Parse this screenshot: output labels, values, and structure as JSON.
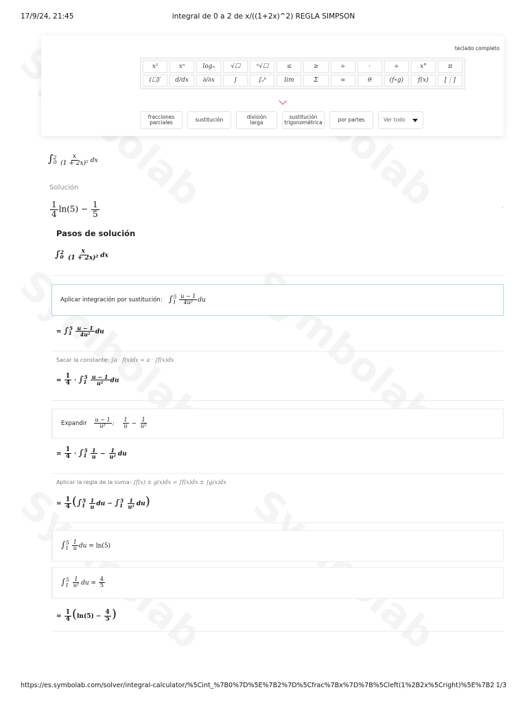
{
  "print_header": {
    "date": "17/9/24, 21:45",
    "title": "integral de 0 a 2 de x/((1+2x)^2) REGLA SIMPSON"
  },
  "watermark": {
    "text": "Symbolab"
  },
  "keyboard": {
    "full_keyboard_label": "teclado completo",
    "keys_row1": [
      "x²",
      "xⁿ",
      "logₙ",
      "√☐",
      "ⁿ√☐",
      "≤",
      "≥",
      "÷",
      "·",
      "÷",
      "x°",
      "π"
    ],
    "keys_row2": [
      "(☐)′",
      "d/dx",
      "∂/∂x",
      "∫",
      "∫ₐᵇ",
      "lim",
      "Σ",
      "∞",
      "θ",
      "(f∘g)",
      "f(x)",
      "[⋮]"
    ],
    "tabs": [
      "fracciones parciales",
      "sustitución",
      "división larga",
      "sustitución trigonométrica",
      "por partes"
    ],
    "select_value": "Ver todo"
  },
  "problem": {
    "lower": "0",
    "upper": "2",
    "numerator": "x",
    "denominator": "(1 + 2x)²",
    "differential": "dx"
  },
  "solution": {
    "label": "Solución",
    "coef_num": "1",
    "coef_den": "4",
    "ln": "ln(5)",
    "minus": "−",
    "frac_num": "1",
    "frac_den": "5"
  },
  "steps": {
    "title": "Pasos de solución",
    "step1_label": "Aplicar integración por sustitución:",
    "step2_label": "Sacar la constante:",
    "step2_rule": "∫a · f(x)dx = a · ∫f(x)dx",
    "step3_label": "Expandir",
    "step4_label": "Aplicar la regla de la suma:",
    "step4_rule": "∫f(x) ± g(x)dx = ∫f(x)dx ± ∫g(x)dx",
    "result_ln": "ln(5)",
    "result_frac_num": "4",
    "result_frac_den": "5"
  },
  "footer": {
    "url": "https://es.symbolab.com/solver/integral-calculator/%5Cint_%7B0%7D%5E%7B2%7D%5Cfrac%7Bx%7D%7B%5Cleft(1%2B2x%5Cright)%5E%7B2%7D%…",
    "page": "1/3"
  }
}
